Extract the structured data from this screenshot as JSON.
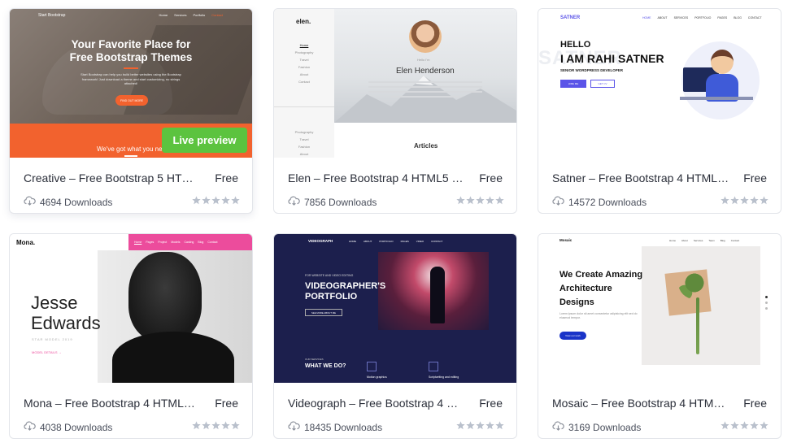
{
  "cards": [
    {
      "name": "Creative – Free Bootstrap 5 HTM…",
      "price": "Free",
      "downloads": "4694 Downloads",
      "live_preview": "Live preview",
      "thumb": {
        "brand": "Start Bootstrap",
        "nav": [
          "Home",
          "Services",
          "Portfolio",
          "Contact"
        ],
        "headline_1": "Your Favorite Place for",
        "headline_2": "Free Bootstrap Themes",
        "sub": "Start Bootstrap can help you build better websites using the Bootstrap framework! Just download a theme and start customizing, no strings attached!",
        "cta": "FIND OUT MORE",
        "bottom": "We've got what you need"
      }
    },
    {
      "name": "Elen – Free Bootstrap 4 HTML5 …",
      "price": "Free",
      "downloads": "7856 Downloads",
      "thumb": {
        "logo": "elen.",
        "menu": [
          "Home",
          "Photography",
          "Travel",
          "Fashion",
          "About",
          "Contact"
        ],
        "menu_2": [
          "Photography",
          "Travel",
          "Fashion",
          "About"
        ],
        "hello": "Hello I'm",
        "person": "Elen Henderson",
        "section": "Articles"
      }
    },
    {
      "name": "Satner – Free Bootstrap 4 HTML…",
      "price": "Free",
      "downloads": "14572 Downloads",
      "thumb": {
        "logo": "SATNER",
        "nav": [
          "HOME",
          "ABOUT",
          "SERVICES",
          "PORTFOLIO",
          "PAGES",
          "BLOG",
          "CONTACT"
        ],
        "hello": "HELLO",
        "name_line": "I AM RAHI SATNER",
        "bg_word": "SATNER",
        "role": "SENIOR WORDPRESS DEVELOPER",
        "btn_1": "HIRE ME",
        "btn_2": "GET CV"
      }
    },
    {
      "name": "Mona – Free Bootstrap 4 HTML5 …",
      "price": "Free",
      "downloads": "4038 Downloads",
      "thumb": {
        "logo": "Mona.",
        "nav": [
          "Home",
          "Pages",
          "Project",
          "Models",
          "Casting",
          "Blog",
          "Contact"
        ],
        "first": "Jesse",
        "last": "Edwards",
        "tag": "STAR MODEL 2019",
        "link": "MODEL DETAILS →"
      }
    },
    {
      "name": "Videograph – Free Bootstrap 4 H…",
      "price": "Free",
      "downloads": "18435 Downloads",
      "thumb": {
        "logo": "VIDEOGRAPH",
        "nav": [
          "HOME",
          "ABOUT",
          "PORTFOLIO",
          "PAGES",
          "VIDEO",
          "CONTACT"
        ],
        "kicker": "FOR WEBSITE AND VIDEO EDITING",
        "title_1": "VIDEOGRAPHER'S",
        "title_2": "PORTFOLIO",
        "btn": "SEE MORE ABOUT ME",
        "services": "OUR SERVICES",
        "what": "WHAT WE DO?",
        "s1": "Motion graphics",
        "s2": "Scriptwriting and editing"
      }
    },
    {
      "name": "Mosaic – Free Bootstrap 4 HTML…",
      "price": "Free",
      "downloads": "3169 Downloads",
      "thumb": {
        "logo": "Mosaic",
        "nav": [
          "Home",
          "About",
          "Services",
          "Team",
          "Blog",
          "Contact"
        ],
        "line_1": "We Create Amazing",
        "line_2": "Architecture",
        "line_3": "Designs",
        "body": "Lorem ipsum dolor sit amet consectetur adipisicing elit sed do eiusmod tempor.",
        "btn": "View our work"
      }
    }
  ],
  "colors": {
    "live_preview": "#5cc33f",
    "creative_orange": "#f2622e",
    "mona_pink": "#ec4c9c",
    "satner_purple": "#5b54e8",
    "videograph_navy": "#1c1f4d",
    "mosaic_blue": "#1a34c8",
    "star": "#b9c0cc"
  },
  "icons": {
    "downloads": "cloud-download-icon",
    "rating": "star-icon"
  }
}
